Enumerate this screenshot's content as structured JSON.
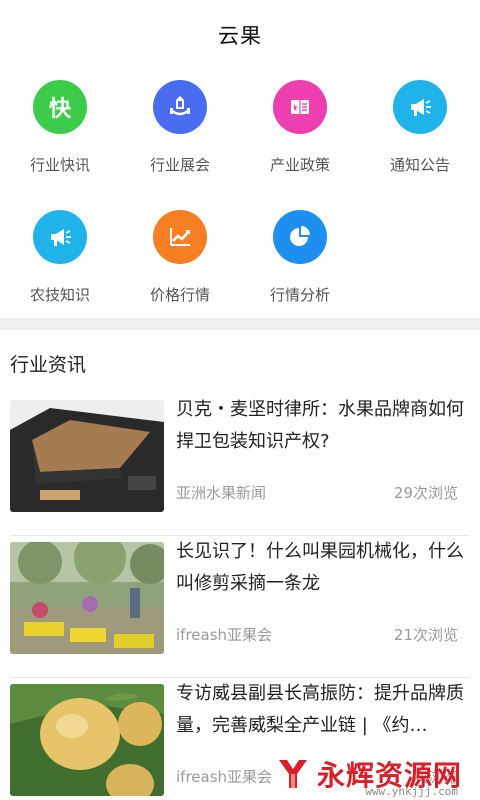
{
  "header": {
    "title": "云果"
  },
  "categories": [
    {
      "label": "行业快讯",
      "icon": "kuai-char-icon",
      "glyph": "快",
      "color": "#3dcc4a"
    },
    {
      "label": "行业展会",
      "icon": "exhibition-icon",
      "color": "#4a6cf0"
    },
    {
      "label": "产业政策",
      "icon": "policy-book-icon",
      "color": "#ee3fb1"
    },
    {
      "label": "通知公告",
      "icon": "megaphone-icon",
      "color": "#20b3ea"
    },
    {
      "label": "农技知识",
      "icon": "megaphone-icon",
      "color": "#20b3ea"
    },
    {
      "label": "价格行情",
      "icon": "price-trend-icon",
      "color": "#f57f22"
    },
    {
      "label": "行情分析",
      "icon": "pie-chart-icon",
      "color": "#1f8ef1"
    }
  ],
  "section": {
    "title": "行业资讯"
  },
  "news": [
    {
      "title": "贝克・麦坚时律所：水果品牌商如何捍卫包装知识产权?",
      "source": "亚洲水果新闻",
      "views": "29次浏览"
    },
    {
      "title": "长见识了！什么叫果园机械化，什么叫修剪采摘一条龙",
      "source": "ifreash亚果会",
      "views": "21次浏览"
    },
    {
      "title": "专访威县副县长高振防：提升品牌质量，完善威梨全产业链 | 《约…",
      "source": "ifreash亚果会",
      "views": "次浏览"
    }
  ],
  "watermark": {
    "text": "永辉资源网",
    "url": "www.yhkjjj.com"
  }
}
